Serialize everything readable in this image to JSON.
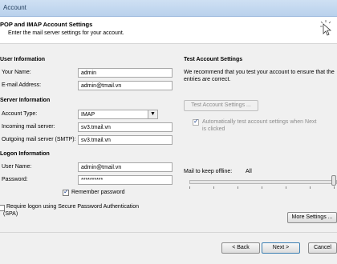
{
  "window": {
    "title": "Account"
  },
  "header": {
    "title": "POP and IMAP Account Settings",
    "subtitle": "Enter the mail server settings for your account."
  },
  "user_info": {
    "section": "User Information",
    "name_label": "Your Name:",
    "name_value": "admin",
    "email_label": "E-mail Address:",
    "email_value": "admin@tmail.vn"
  },
  "server_info": {
    "section": "Server Information",
    "account_type_label": "Account Type:",
    "account_type_value": "IMAP",
    "incoming_label": "Incoming mail server:",
    "incoming_value": "sv3.tmail.vn",
    "outgoing_label": "Outgoing mail server (SMTP):",
    "outgoing_value": "sv3.tmail.vn"
  },
  "logon_info": {
    "section": "Logon Information",
    "username_label": "User Name:",
    "username_value": "admin@tmail.vn",
    "password_label": "Password:",
    "password_value": "**********",
    "remember_label": "Remember password",
    "remember_checked": true,
    "spa_label_line1": "Require logon using Secure Password Authentication",
    "spa_label_line2": "(SPA)",
    "spa_checked": false
  },
  "test_settings": {
    "title": "Test Account Settings",
    "description": "We recommend that you test your account to ensure that the entries are correct.",
    "button": "Test Account Settings ...",
    "auto_test_line1": "Automatically test account settings when Next",
    "auto_test_line2": "is clicked",
    "auto_test_checked": true
  },
  "offline": {
    "label": "Mail to keep offline:",
    "value": "All",
    "level_fraction": 1.0
  },
  "more_settings_button": "More Settings ...",
  "footer": {
    "back_button": "< Back",
    "next_button": "Next >",
    "cancel_button": "Cancel"
  }
}
